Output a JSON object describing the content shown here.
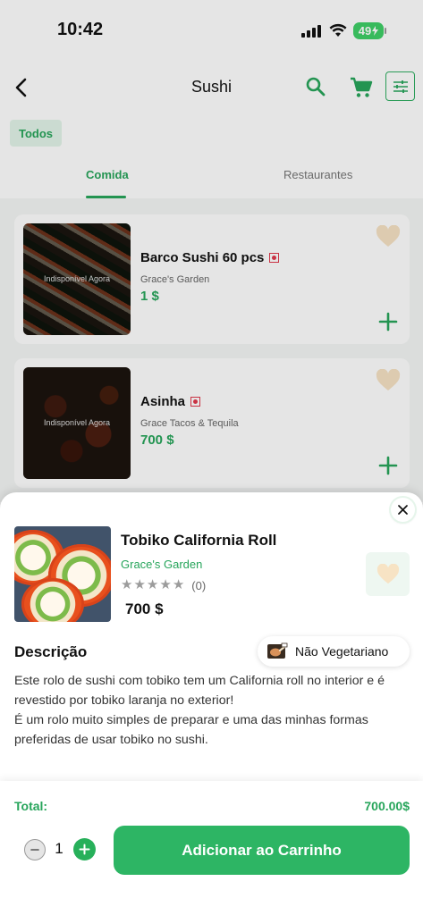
{
  "status_bar": {
    "time": "10:42",
    "battery": "49"
  },
  "header": {
    "title": "Sushi"
  },
  "filter_chip": {
    "label": "Todos"
  },
  "tabs": [
    {
      "label": "Comida",
      "active": true
    },
    {
      "label": "Restaurantes",
      "active": false
    }
  ],
  "products": [
    {
      "name": "Barco Sushi 60 pcs",
      "restaurant": "Grace's Garden",
      "price": "1 $",
      "overlay": "Indisponível Agora"
    },
    {
      "name": "Asinha",
      "restaurant": "Grace Tacos & Tequila",
      "price": "700 $",
      "overlay": "Indisponível Agora"
    }
  ],
  "sheet": {
    "title": "Tobiko California Roll",
    "restaurant": "Grace's Garden",
    "rating": 0,
    "rating_count": "(0)",
    "price": "700 $",
    "description_title": "Descrição",
    "diet_badge": "Não Vegetariano",
    "description": "Este rolo de sushi com tobiko tem um California roll no interior e é revestido por tobiko laranja no exterior!\nÉ um rolo muito simples de preparar e uma das minhas formas preferidas de usar tobiko no sushi.",
    "total_label": "Total:",
    "total_value": "700.00$",
    "quantity": "1",
    "add_button": "Adicionar ao Carrinho"
  },
  "colors": {
    "accent": "#27a55b",
    "button": "#2db564",
    "heart": "#f7e3c4",
    "nonveg": "#e0384b"
  }
}
